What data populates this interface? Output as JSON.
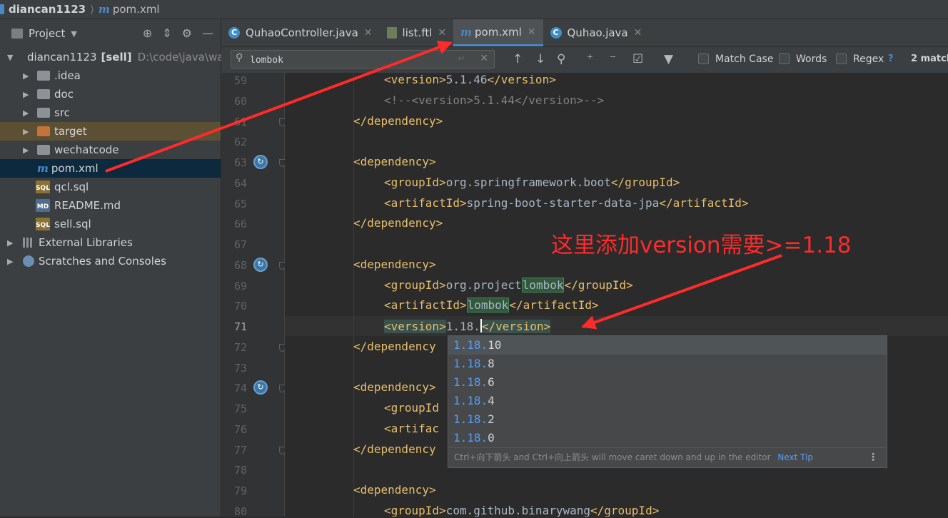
{
  "breadcrumb": {
    "project": "diancan1123",
    "file_icon": "m",
    "file": "pom.xml"
  },
  "project_panel": {
    "title": "Project",
    "root": {
      "name": "diancan1123",
      "module": "[sell]",
      "path": "D:\\code\\java\\wa"
    },
    "items": [
      {
        "name": ".idea",
        "type": "folder"
      },
      {
        "name": "doc",
        "type": "folder"
      },
      {
        "name": "src",
        "type": "folder"
      },
      {
        "name": "target",
        "type": "folder-excluded"
      },
      {
        "name": "wechatcode",
        "type": "folder"
      },
      {
        "name": "pom.xml",
        "type": "maven"
      },
      {
        "name": "qcl.sql",
        "type": "sql"
      },
      {
        "name": "README.md",
        "type": "md"
      },
      {
        "name": "sell.sql",
        "type": "sql"
      }
    ],
    "external_libraries": "External Libraries",
    "scratches": "Scratches and Consoles",
    "file_badges": {
      "sql": "SQL",
      "md": "MD"
    }
  },
  "tabs": [
    {
      "label": "QuhaoController.java",
      "icon": "C"
    },
    {
      "label": "list.ftl",
      "icon": "ftl"
    },
    {
      "label": "pom.xml",
      "icon": "m",
      "active": true
    },
    {
      "label": "Quhao.java",
      "icon": "C"
    }
  ],
  "find": {
    "query": "lombok",
    "match_case": "Match Case",
    "words": "Words",
    "regex": "Regex",
    "help": "?",
    "matches": "2 match"
  },
  "line_numbers": [
    "59",
    "60",
    "61",
    "62",
    "63",
    "64",
    "65",
    "66",
    "67",
    "68",
    "69",
    "70",
    "71",
    "72",
    "73",
    "74",
    "75",
    "76",
    "77",
    "78",
    "79",
    "80"
  ],
  "code": {
    "l59": {
      "open": "<version>",
      "text": "5.1.46",
      "close": "</version>"
    },
    "l60": "<!--<version>5.1.44</version>-->",
    "l61": "</dependency>",
    "l63": "<dependency>",
    "l64": {
      "open": "<groupId>",
      "text": "org.springframework.boot",
      "close": "</groupId>"
    },
    "l65": {
      "open": "<artifactId>",
      "text": "spring-boot-starter-data-jpa",
      "close": "</artifactId>"
    },
    "l66": "</dependency>",
    "l68": "<dependency>",
    "l69": {
      "open": "<groupId>",
      "text": "org.project",
      "match": "lombok",
      "close": "</groupId>"
    },
    "l70": {
      "open": "<artifactId>",
      "match": "lombok",
      "close": "</artifactId>"
    },
    "l71": {
      "open": "<version>",
      "text": "1.18.",
      "close": "</version>"
    },
    "l72": "</dependency",
    "l74": "<dependency>",
    "l75": "<groupId",
    "l76": "<artifac",
    "l77": "</dependency",
    "l79": "<dependency>",
    "l80": {
      "open": "<groupId>",
      "text": "com.github.binarywang",
      "close": "</groupId>"
    }
  },
  "completion": {
    "prefix": "1.18.",
    "items": [
      "10",
      "8",
      "6",
      "4",
      "2",
      "0"
    ],
    "footer": "Ctrl+向下箭头 and Ctrl+向上箭头 will move caret down and up in the editor",
    "next_tip": "Next Tip"
  },
  "annotation": {
    "text": "这里添加version需要>=1.18",
    "color": "#ff2a2a"
  },
  "colors": {
    "tag": "#e8bf6a",
    "text": "#a9b7c6",
    "accent": "#4a88c7",
    "match": "#589df6"
  }
}
